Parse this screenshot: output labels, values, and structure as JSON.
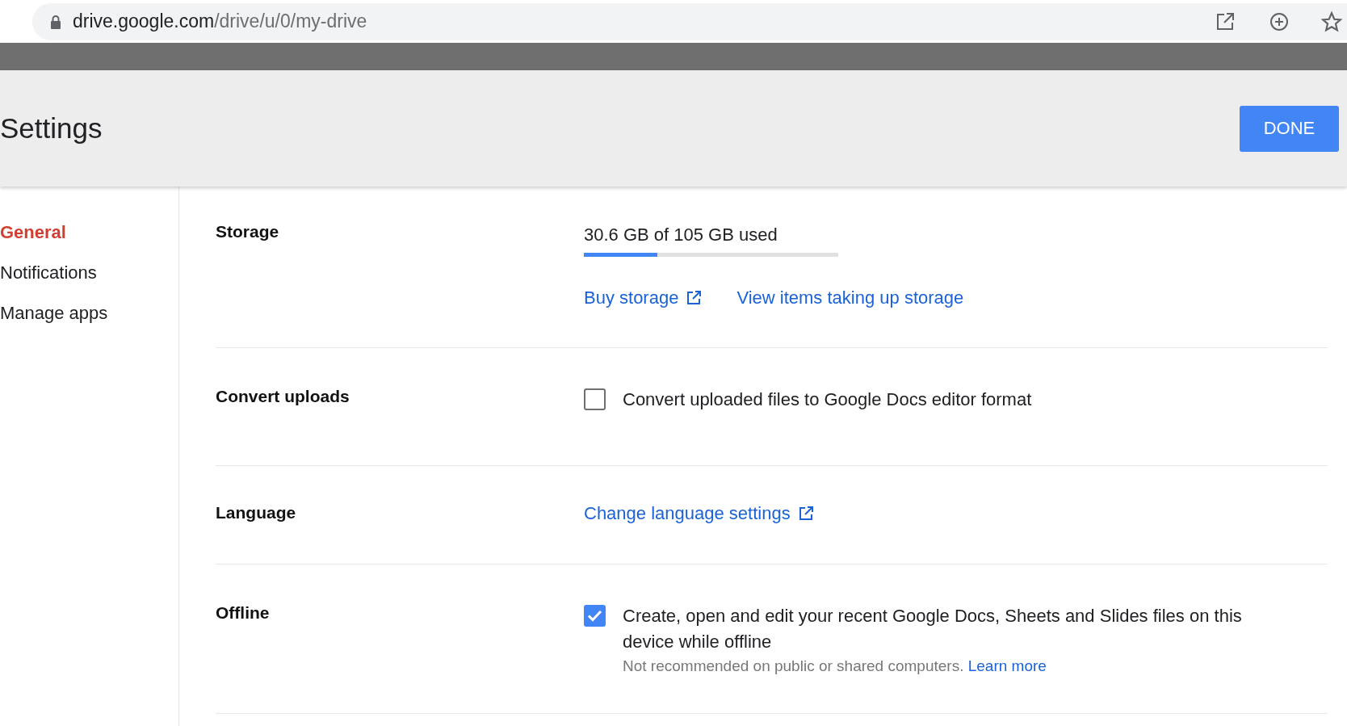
{
  "browser": {
    "url_host": "drive.google.com",
    "url_path": "/drive/u/0/my-drive"
  },
  "header": {
    "title": "Settings",
    "done_button": "DONE"
  },
  "sidebar": {
    "items": [
      {
        "label": "General",
        "selected": true
      },
      {
        "label": "Notifications",
        "selected": false
      },
      {
        "label": "Manage apps",
        "selected": false
      }
    ]
  },
  "sections": [
    {
      "kind": "storage",
      "label": "Storage",
      "usage": "30.6 GB of 105 GB used",
      "level": 0.29,
      "links": [
        {
          "text": "Buy storage",
          "external": true
        },
        {
          "text": "View items taking up storage",
          "external": false
        }
      ]
    },
    {
      "kind": "checkbox",
      "label": "Convert uploads",
      "checked": false,
      "text": "Convert uploaded files to Google Docs editor format"
    },
    {
      "kind": "link",
      "label": "Language",
      "link": {
        "text": "Change language settings",
        "external": true
      }
    },
    {
      "kind": "checkbox",
      "label": "Offline",
      "checked": true,
      "text": "Create, open and edit your recent Google Docs, Sheets and Slides files on this device while offline",
      "note": "Not recommended on public or shared computers.",
      "note_link": "Learn more"
    }
  ]
}
